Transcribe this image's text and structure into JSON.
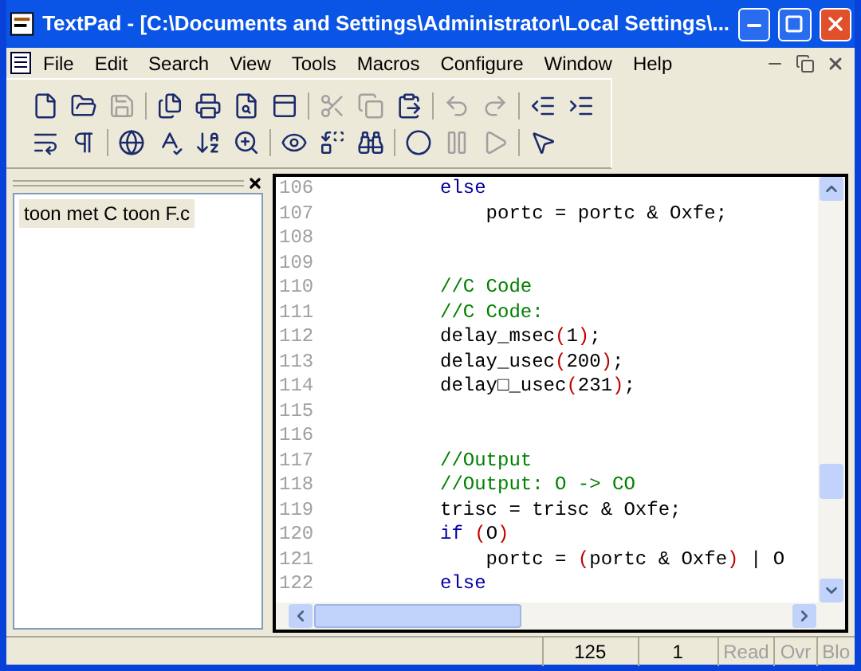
{
  "window": {
    "title": "TextPad - [C:\\Documents and Settings\\Administrator\\Local Settings\\..."
  },
  "menu": [
    "File",
    "Edit",
    "Search",
    "View",
    "Tools",
    "Macros",
    "Configure",
    "Window",
    "Help"
  ],
  "toolbar_rows": [
    [
      [
        {
          "disabled": false
        },
        {
          "disabled": false
        },
        {
          "disabled": true
        }
      ],
      [
        {
          "disabled": false
        },
        {
          "disabled": false
        },
        {
          "disabled": false
        },
        {
          "disabled": false
        }
      ],
      [
        {
          "disabled": true
        },
        {
          "disabled": true
        },
        {
          "disabled": false
        }
      ],
      [
        {
          "disabled": true
        },
        {
          "disabled": true
        }
      ],
      [
        {
          "disabled": false
        },
        {
          "disabled": false
        }
      ]
    ],
    [
      [
        {
          "disabled": false
        },
        {
          "disabled": false
        }
      ],
      [
        {
          "disabled": false
        },
        {
          "disabled": false
        },
        {
          "disabled": false
        },
        {
          "disabled": false
        }
      ],
      [
        {
          "disabled": false
        },
        {
          "disabled": false
        },
        {
          "disabled": false
        }
      ],
      [
        {
          "disabled": false
        },
        {
          "disabled": true
        },
        {
          "disabled": true
        }
      ],
      [
        {
          "disabled": false
        }
      ]
    ]
  ],
  "documents": [
    {
      "name": "toon met C toon F.c",
      "selected": true
    }
  ],
  "editor": {
    "lines": [
      {
        "number": "106",
        "segments": [
          {
            "kind": "keyword",
            "text": "else"
          }
        ]
      },
      {
        "number": "107",
        "segments": [
          {
            "kind": "plain",
            "text": "    portc = portc & Oxfe;"
          }
        ]
      },
      {
        "number": "108"
      },
      {
        "number": "109"
      },
      {
        "number": "110",
        "segments": [
          {
            "kind": "comment",
            "text": "//C Code"
          }
        ]
      },
      {
        "number": "111",
        "segments": [
          {
            "kind": "comment",
            "text": "//C Code:"
          }
        ]
      },
      {
        "number": "112",
        "segments": [
          {
            "kind": "plain",
            "text": "delay_msec"
          },
          {
            "kind": "paren",
            "text": "("
          },
          {
            "kind": "plain",
            "text": "1"
          },
          {
            "kind": "paren",
            "text": ")"
          },
          {
            "kind": "plain",
            "text": ";"
          }
        ]
      },
      {
        "number": "113",
        "segments": [
          {
            "kind": "plain",
            "text": "delay_usec"
          },
          {
            "kind": "paren",
            "text": "("
          },
          {
            "kind": "plain",
            "text": "200"
          },
          {
            "kind": "paren",
            "text": ")"
          },
          {
            "kind": "plain",
            "text": ";"
          }
        ]
      },
      {
        "number": "114",
        "segments": [
          {
            "kind": "plain",
            "text": "delay□_usec"
          },
          {
            "kind": "paren",
            "text": "("
          },
          {
            "kind": "plain",
            "text": "231"
          },
          {
            "kind": "paren",
            "text": ")"
          },
          {
            "kind": "plain",
            "text": ";"
          }
        ]
      },
      {
        "number": "115"
      },
      {
        "number": "116"
      },
      {
        "number": "117",
        "segments": [
          {
            "kind": "comment",
            "text": "//Output"
          }
        ]
      },
      {
        "number": "118",
        "segments": [
          {
            "kind": "comment",
            "text": "//Output: O -> CO"
          }
        ]
      },
      {
        "number": "119",
        "segments": [
          {
            "kind": "plain",
            "text": "trisc = trisc & Oxfe;"
          }
        ]
      },
      {
        "number": "120",
        "segments": [
          {
            "kind": "keyword",
            "text": "if"
          },
          {
            "kind": "paren",
            "text": " ("
          },
          {
            "kind": "plain",
            "text": "O"
          },
          {
            "kind": "paren",
            "text": ")"
          }
        ]
      },
      {
        "number": "121",
        "segments": [
          {
            "kind": "plain",
            "text": "    portc = "
          },
          {
            "kind": "paren",
            "text": "("
          },
          {
            "kind": "plain",
            "text": "portc & Oxfe"
          },
          {
            "kind": "paren",
            "text": ")"
          },
          {
            "kind": "plain",
            "text": " | O"
          }
        ]
      },
      {
        "number": "122",
        "segments": [
          {
            "kind": "keyword",
            "text": "else"
          }
        ]
      }
    ]
  },
  "status_bar": {
    "line": "125",
    "column": "1",
    "indicators": [
      {
        "text": "Read",
        "disabled": true
      },
      {
        "text": "Ovr",
        "disabled": true
      },
      {
        "text": "Blo",
        "disabled": true
      }
    ]
  }
}
